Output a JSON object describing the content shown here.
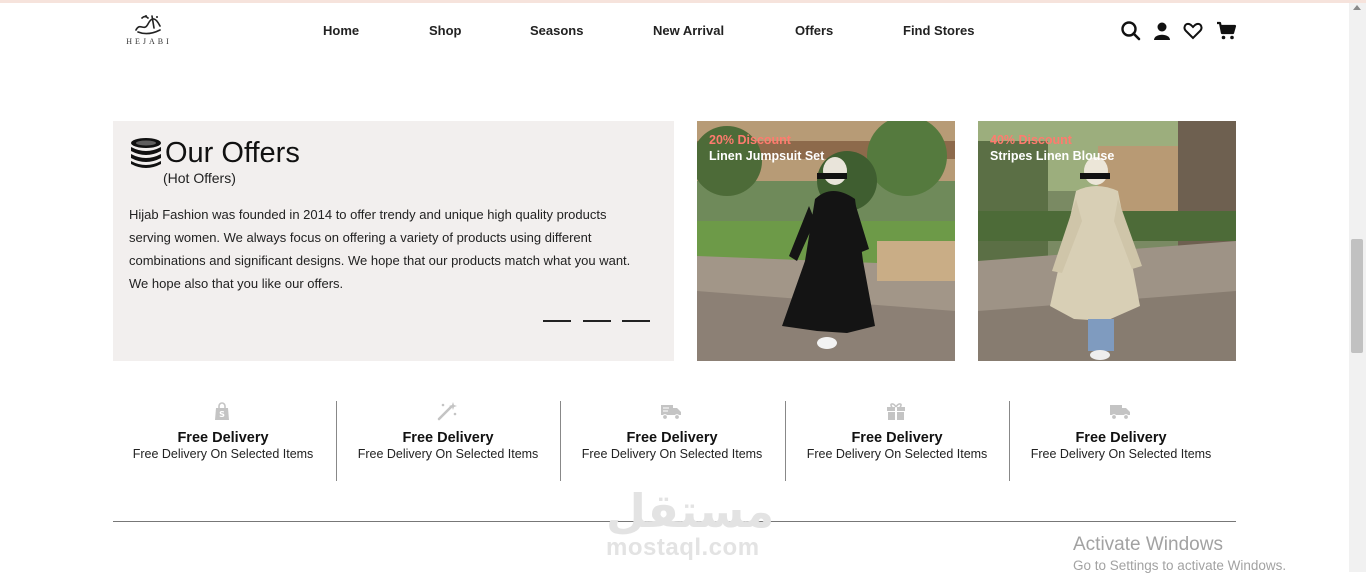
{
  "brand": {
    "logo_text": "HEJABI"
  },
  "nav": {
    "items": [
      {
        "label": "Home"
      },
      {
        "label": "Shop"
      },
      {
        "label": "Seasons"
      },
      {
        "label": "New Arrival"
      },
      {
        "label": "Offers"
      },
      {
        "label": "Find Stores"
      }
    ]
  },
  "header_icons": [
    "search-icon",
    "user-icon",
    "heart-icon",
    "cart-icon"
  ],
  "offers": {
    "title": "Our Offers",
    "subtitle": "(Hot Offers)",
    "description": "Hijab Fashion was founded in 2014 to offer trendy and unique high quality products serving women. We always focus on offering a variety of products using different combinations and significant designs. We hope that our products match what you want. We hope also that you like our offers.",
    "slider_dots": 3
  },
  "products": [
    {
      "discount": "20% Discount",
      "name": "Linen Jumpsuit Set"
    },
    {
      "discount": "40% Discount",
      "name": "Stripes Linen Blouse"
    }
  ],
  "features": [
    {
      "icon": "shopping-bag-icon",
      "title": "Free Delivery",
      "subtitle": "Free Delivery On Selected Items"
    },
    {
      "icon": "magic-wand-icon",
      "title": "Free Delivery",
      "subtitle": "Free Delivery On Selected Items"
    },
    {
      "icon": "truck-icon",
      "title": "Free Delivery",
      "subtitle": "Free Delivery On Selected Items"
    },
    {
      "icon": "gift-icon",
      "title": "Free Delivery",
      "subtitle": "Free Delivery On Selected Items"
    },
    {
      "icon": "truck-icon",
      "title": "Free Delivery",
      "subtitle": "Free Delivery On Selected Items"
    }
  ],
  "watermark": {
    "arabic": "مستقل",
    "latin": "mostaql.com"
  },
  "os_overlay": {
    "title": "Activate Windows",
    "subtitle": "Go to Settings to activate Windows."
  },
  "colors": {
    "discount": "#ff7b6e",
    "offers_bg": "#f2efee",
    "text": "#111111"
  }
}
